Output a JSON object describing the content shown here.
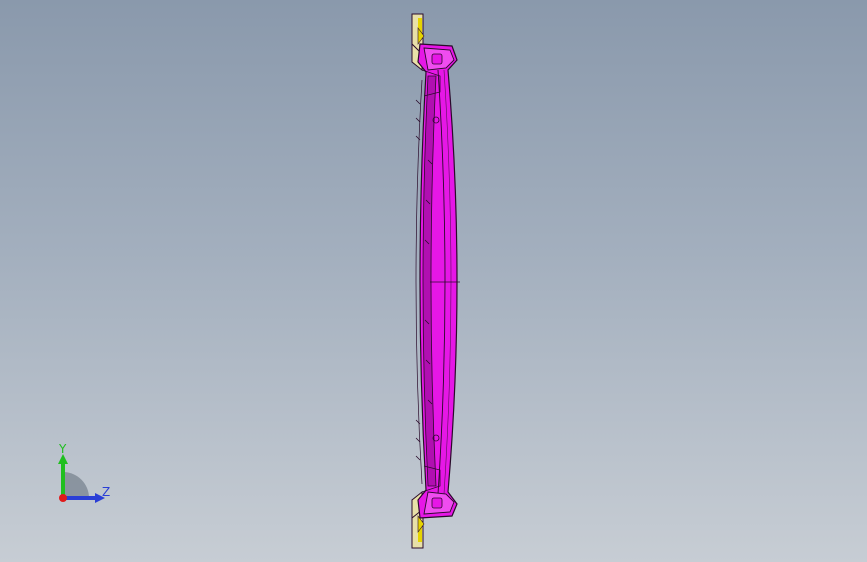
{
  "triad": {
    "y_label": "Y",
    "z_label": "Z"
  },
  "colors": {
    "part_face": "#e617e6",
    "part_edge": "#2a0a2a",
    "flange_face": "#e8e0a8",
    "flange_accent": "#e6d400",
    "y_axis": "#1fbf1f",
    "z_axis": "#2a3ed6",
    "x_axis_dot": "#e01a1a",
    "triad_arc": "#7d8793"
  },
  "icons": {
    "triad": "coordinate-triad-icon"
  }
}
